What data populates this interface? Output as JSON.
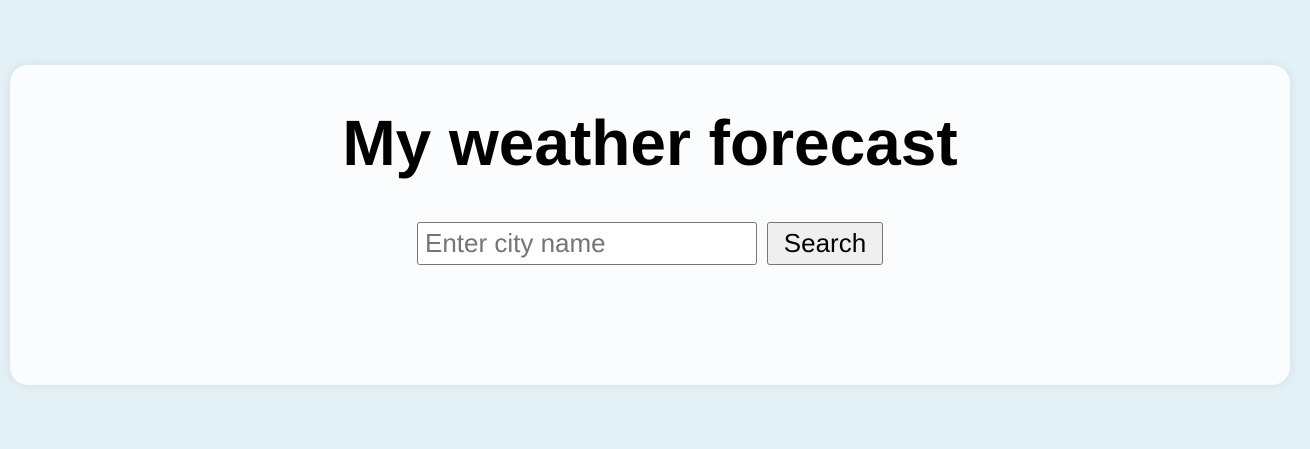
{
  "page": {
    "title": "My weather forecast"
  },
  "search": {
    "placeholder": "Enter city name",
    "value": "",
    "button_label": "Search"
  },
  "colors": {
    "page_background": "#e3f0f5",
    "card_background": "#fbfcfe",
    "button_background": "#efefef"
  }
}
